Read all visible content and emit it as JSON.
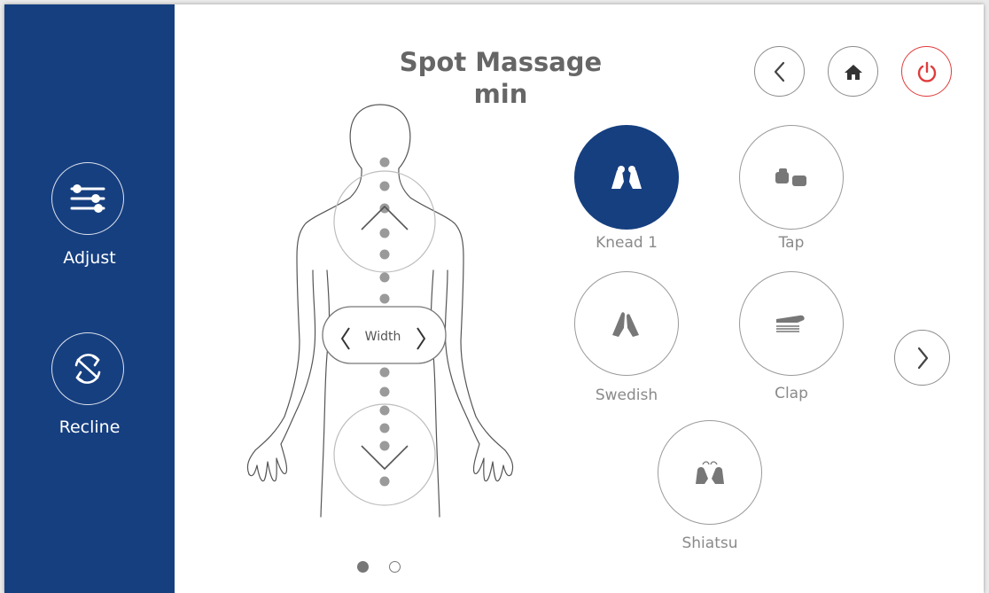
{
  "sidebar": {
    "items": [
      {
        "label": "Adjust",
        "icon": "sliders-icon"
      },
      {
        "label": "Recline",
        "icon": "recline-icon"
      }
    ]
  },
  "header": {
    "title": "Spot Massage",
    "subtitle": "min"
  },
  "nav": {
    "back_icon": "back-chevron-icon",
    "home_icon": "home-icon",
    "power_icon": "power-icon"
  },
  "body_map": {
    "width_label": "Width",
    "up_icon": "chevron-up-icon",
    "down_icon": "chevron-down-icon"
  },
  "modes": [
    {
      "label": "Knead 1",
      "active": true
    },
    {
      "label": "Tap",
      "active": false
    },
    {
      "label": "Swedish",
      "active": false
    },
    {
      "label": "Clap",
      "active": false
    },
    {
      "label": "Shiatsu",
      "active": false
    }
  ],
  "pagination": {
    "current": 1,
    "total": 2
  },
  "colors": {
    "sidebar": "#163f80",
    "accent": "#163f80",
    "power": "#e03c3c",
    "text": "#666666"
  }
}
